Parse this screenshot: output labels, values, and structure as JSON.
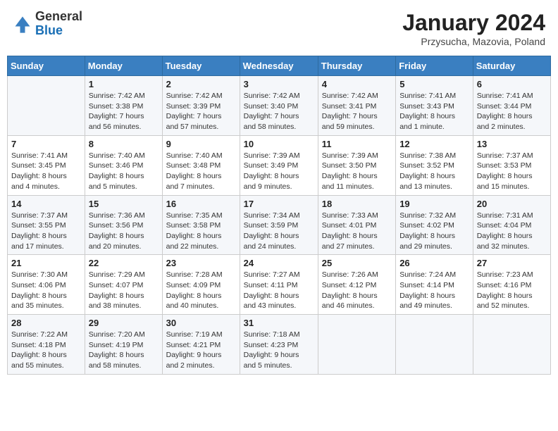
{
  "header": {
    "logo": {
      "line1": "General",
      "line2": "Blue"
    },
    "title": "January 2024",
    "subtitle": "Przysucha, Mazovia, Poland"
  },
  "calendar": {
    "weekdays": [
      "Sunday",
      "Monday",
      "Tuesday",
      "Wednesday",
      "Thursday",
      "Friday",
      "Saturday"
    ],
    "weeks": [
      [
        {
          "day": "",
          "info": ""
        },
        {
          "day": "1",
          "info": "Sunrise: 7:42 AM\nSunset: 3:38 PM\nDaylight: 7 hours\nand 56 minutes."
        },
        {
          "day": "2",
          "info": "Sunrise: 7:42 AM\nSunset: 3:39 PM\nDaylight: 7 hours\nand 57 minutes."
        },
        {
          "day": "3",
          "info": "Sunrise: 7:42 AM\nSunset: 3:40 PM\nDaylight: 7 hours\nand 58 minutes."
        },
        {
          "day": "4",
          "info": "Sunrise: 7:42 AM\nSunset: 3:41 PM\nDaylight: 7 hours\nand 59 minutes."
        },
        {
          "day": "5",
          "info": "Sunrise: 7:41 AM\nSunset: 3:43 PM\nDaylight: 8 hours\nand 1 minute."
        },
        {
          "day": "6",
          "info": "Sunrise: 7:41 AM\nSunset: 3:44 PM\nDaylight: 8 hours\nand 2 minutes."
        }
      ],
      [
        {
          "day": "7",
          "info": "Sunrise: 7:41 AM\nSunset: 3:45 PM\nDaylight: 8 hours\nand 4 minutes."
        },
        {
          "day": "8",
          "info": "Sunrise: 7:40 AM\nSunset: 3:46 PM\nDaylight: 8 hours\nand 5 minutes."
        },
        {
          "day": "9",
          "info": "Sunrise: 7:40 AM\nSunset: 3:48 PM\nDaylight: 8 hours\nand 7 minutes."
        },
        {
          "day": "10",
          "info": "Sunrise: 7:39 AM\nSunset: 3:49 PM\nDaylight: 8 hours\nand 9 minutes."
        },
        {
          "day": "11",
          "info": "Sunrise: 7:39 AM\nSunset: 3:50 PM\nDaylight: 8 hours\nand 11 minutes."
        },
        {
          "day": "12",
          "info": "Sunrise: 7:38 AM\nSunset: 3:52 PM\nDaylight: 8 hours\nand 13 minutes."
        },
        {
          "day": "13",
          "info": "Sunrise: 7:37 AM\nSunset: 3:53 PM\nDaylight: 8 hours\nand 15 minutes."
        }
      ],
      [
        {
          "day": "14",
          "info": "Sunrise: 7:37 AM\nSunset: 3:55 PM\nDaylight: 8 hours\nand 17 minutes."
        },
        {
          "day": "15",
          "info": "Sunrise: 7:36 AM\nSunset: 3:56 PM\nDaylight: 8 hours\nand 20 minutes."
        },
        {
          "day": "16",
          "info": "Sunrise: 7:35 AM\nSunset: 3:58 PM\nDaylight: 8 hours\nand 22 minutes."
        },
        {
          "day": "17",
          "info": "Sunrise: 7:34 AM\nSunset: 3:59 PM\nDaylight: 8 hours\nand 24 minutes."
        },
        {
          "day": "18",
          "info": "Sunrise: 7:33 AM\nSunset: 4:01 PM\nDaylight: 8 hours\nand 27 minutes."
        },
        {
          "day": "19",
          "info": "Sunrise: 7:32 AM\nSunset: 4:02 PM\nDaylight: 8 hours\nand 29 minutes."
        },
        {
          "day": "20",
          "info": "Sunrise: 7:31 AM\nSunset: 4:04 PM\nDaylight: 8 hours\nand 32 minutes."
        }
      ],
      [
        {
          "day": "21",
          "info": "Sunrise: 7:30 AM\nSunset: 4:06 PM\nDaylight: 8 hours\nand 35 minutes."
        },
        {
          "day": "22",
          "info": "Sunrise: 7:29 AM\nSunset: 4:07 PM\nDaylight: 8 hours\nand 38 minutes."
        },
        {
          "day": "23",
          "info": "Sunrise: 7:28 AM\nSunset: 4:09 PM\nDaylight: 8 hours\nand 40 minutes."
        },
        {
          "day": "24",
          "info": "Sunrise: 7:27 AM\nSunset: 4:11 PM\nDaylight: 8 hours\nand 43 minutes."
        },
        {
          "day": "25",
          "info": "Sunrise: 7:26 AM\nSunset: 4:12 PM\nDaylight: 8 hours\nand 46 minutes."
        },
        {
          "day": "26",
          "info": "Sunrise: 7:24 AM\nSunset: 4:14 PM\nDaylight: 8 hours\nand 49 minutes."
        },
        {
          "day": "27",
          "info": "Sunrise: 7:23 AM\nSunset: 4:16 PM\nDaylight: 8 hours\nand 52 minutes."
        }
      ],
      [
        {
          "day": "28",
          "info": "Sunrise: 7:22 AM\nSunset: 4:18 PM\nDaylight: 8 hours\nand 55 minutes."
        },
        {
          "day": "29",
          "info": "Sunrise: 7:20 AM\nSunset: 4:19 PM\nDaylight: 8 hours\nand 58 minutes."
        },
        {
          "day": "30",
          "info": "Sunrise: 7:19 AM\nSunset: 4:21 PM\nDaylight: 9 hours\nand 2 minutes."
        },
        {
          "day": "31",
          "info": "Sunrise: 7:18 AM\nSunset: 4:23 PM\nDaylight: 9 hours\nand 5 minutes."
        },
        {
          "day": "",
          "info": ""
        },
        {
          "day": "",
          "info": ""
        },
        {
          "day": "",
          "info": ""
        }
      ]
    ]
  }
}
